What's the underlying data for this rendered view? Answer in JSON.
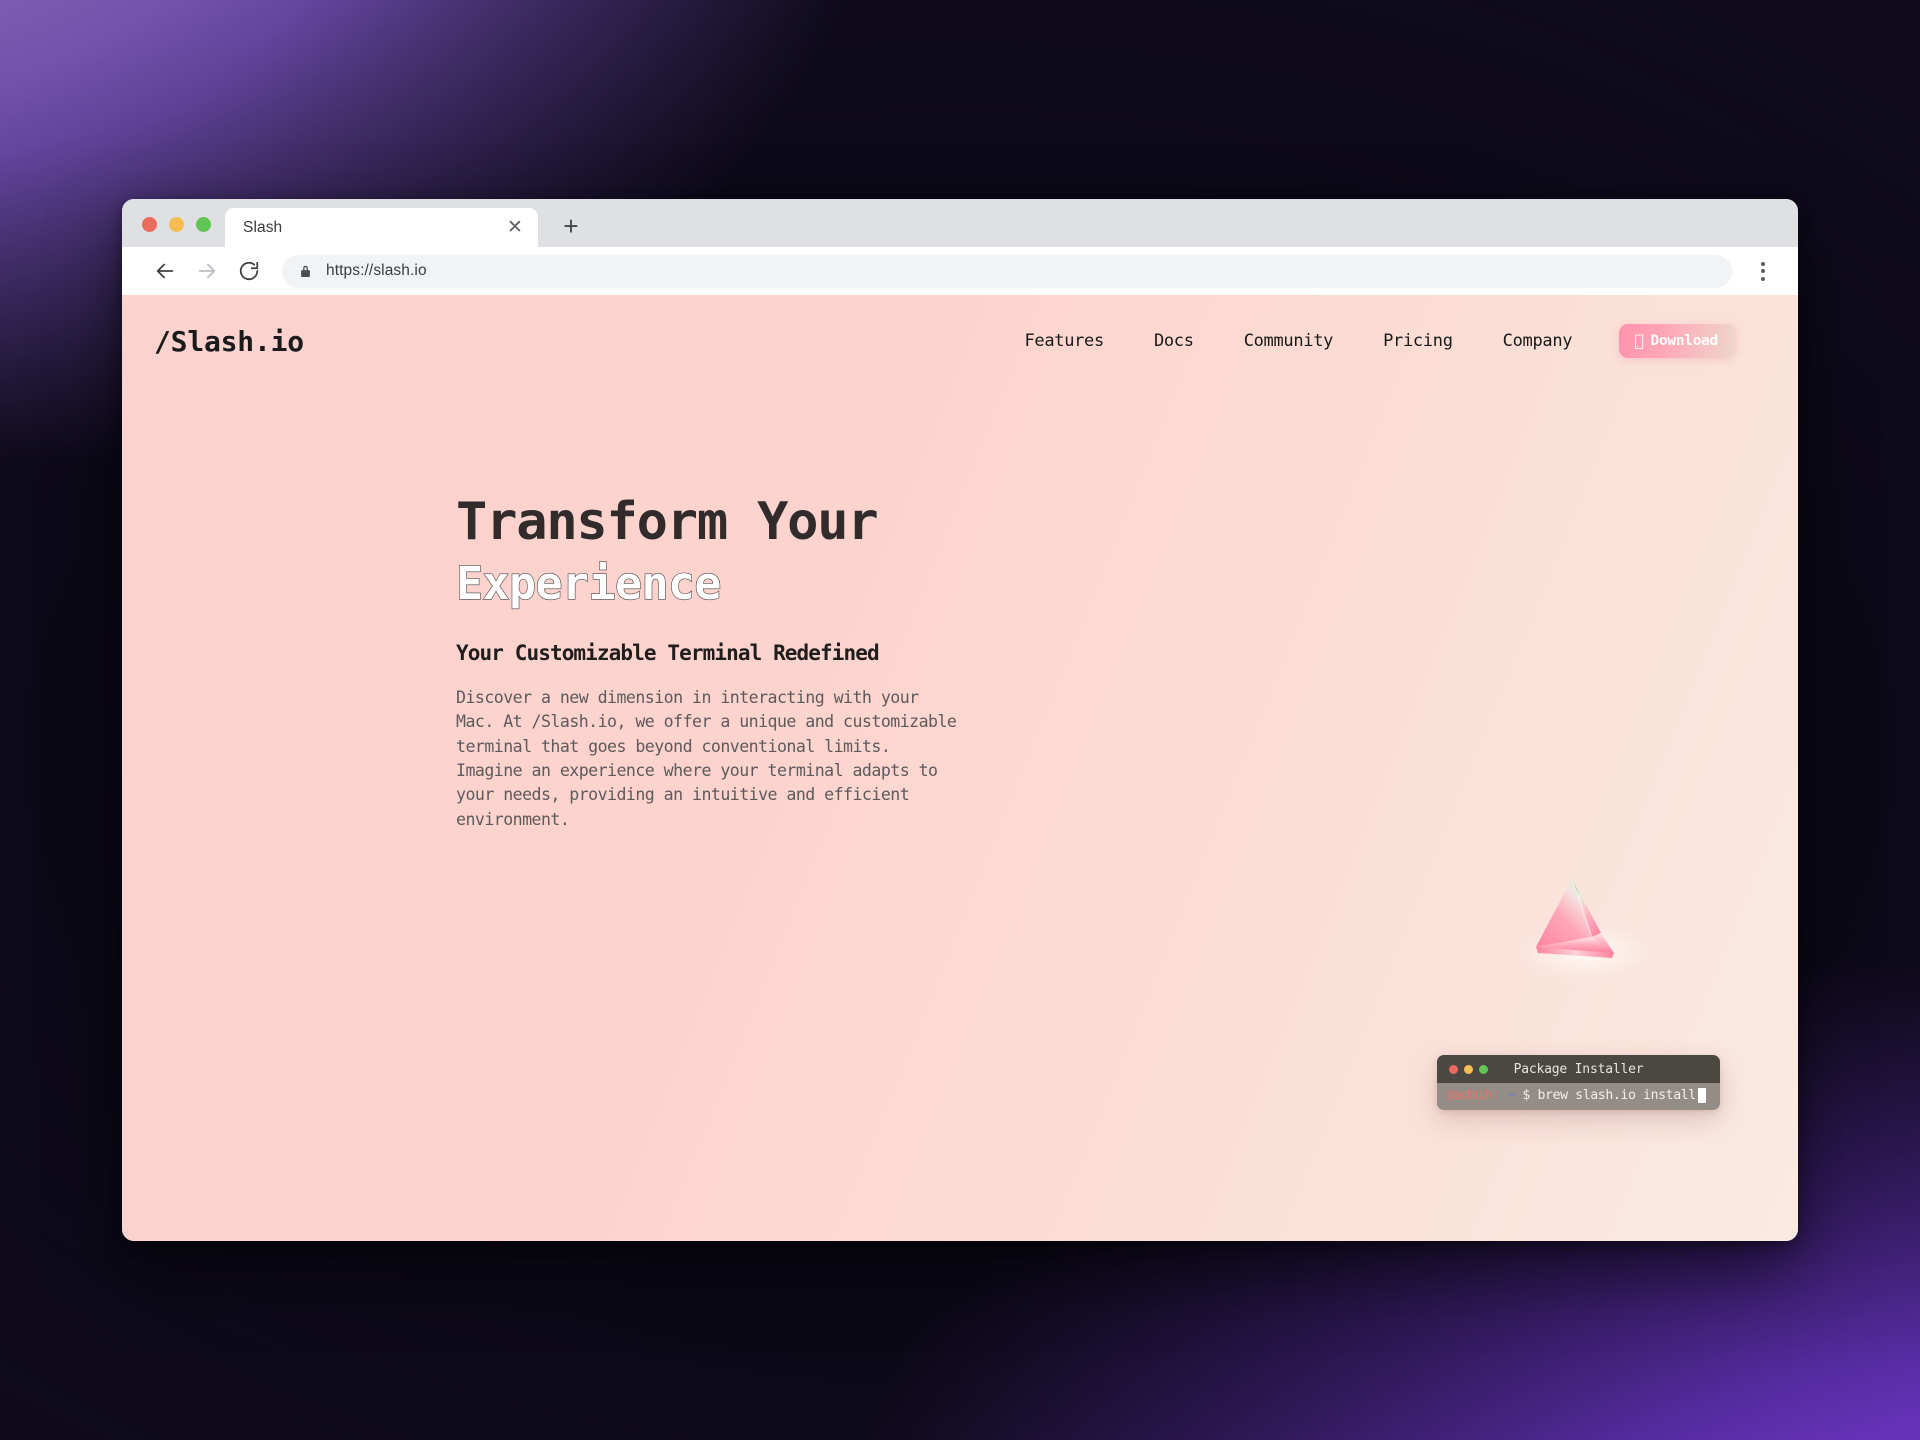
{
  "browser": {
    "window_controls": [
      "close",
      "minimize",
      "maximize"
    ],
    "tab": {
      "title": "Slash",
      "close_icon": "close-icon"
    },
    "new_tab_label": "+",
    "nav": {
      "back_icon": "arrow-left-icon",
      "forward_icon": "arrow-right-icon",
      "reload_icon": "reload-icon",
      "menu_icon": "kebab-menu-icon"
    },
    "omnibox": {
      "lock_icon": "lock-icon",
      "url": "https://slash.io"
    }
  },
  "site": {
    "logo": "/Slash.io",
    "nav_links": [
      {
        "label": "Features"
      },
      {
        "label": "Docs"
      },
      {
        "label": "Community"
      },
      {
        "label": "Pricing"
      },
      {
        "label": "Company"
      }
    ],
    "download_button": {
      "label": "Download",
      "icon": "apple-logo-icon"
    },
    "hero": {
      "headline_line1": "Transform Your",
      "headline_line2": "Experience",
      "subheadline": "Your Customizable Terminal Redefined",
      "body": "Discover a new dimension in interacting with your\nMac. At /Slash.io, we offer a unique and customizable\nterminal that goes beyond conventional limits.\nImagine an experience where your terminal adapts to\nyour needs, providing an intuitive and efficient\nenvironment."
    },
    "terminal": {
      "title": "Package Installer",
      "prompt_user": "@admin:",
      "prompt_path": " ~ ",
      "command": "$ brew slash.io install"
    },
    "colors": {
      "page_bg_left": "#fcd2ce",
      "page_bg_right": "#faeae0",
      "accent_pink": "#ff93ad",
      "heading_dark": "#312b2b",
      "body_text": "#5e5a5c",
      "terminal_bar": "#4b4743",
      "terminal_body": "#938c87",
      "desktop_purple": "#6b35c0"
    }
  }
}
